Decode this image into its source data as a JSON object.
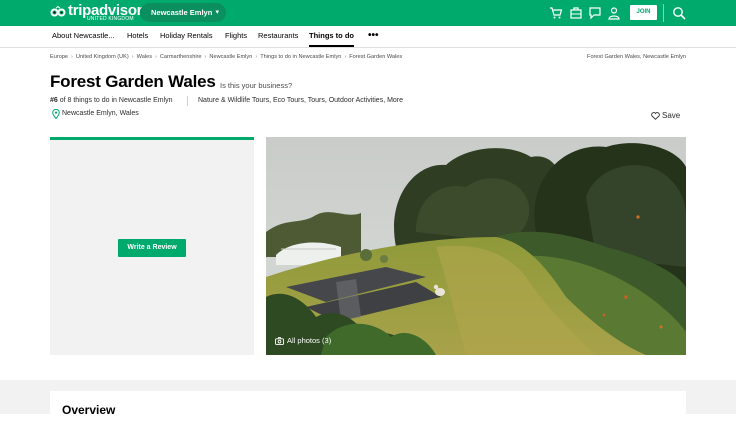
{
  "brand": {
    "name": "tripadvisor",
    "region": "UNITED KINGDOM",
    "green": "#00aa6c"
  },
  "header": {
    "geo_label": "Newcastle Emlyn",
    "join_label": "JOIN",
    "icons": [
      "cart-icon",
      "trips-icon",
      "messages-icon",
      "profile-icon",
      "search-icon"
    ]
  },
  "nav": {
    "items": [
      {
        "label": "About Newcastle..."
      },
      {
        "label": "Hotels"
      },
      {
        "label": "Holiday Rentals"
      },
      {
        "label": "Flights"
      },
      {
        "label": "Restaurants"
      },
      {
        "label": "Things to do",
        "active": true
      }
    ],
    "more": "•••"
  },
  "breadcrumb": {
    "items": [
      "Europe",
      "United Kingdom (UK)",
      "Wales",
      "Carmarthenshire",
      "Newcastle Emlyn",
      "Things to do in Newcastle Emlyn",
      "Forest Garden Wales"
    ],
    "right": "Forest Garden Wales, Newcastle Emlyn"
  },
  "listing": {
    "title": "Forest Garden Wales",
    "claim": "Is this your business?",
    "rank_number": "#6",
    "rank_text": " of 8 things to do in Newcastle Emlyn",
    "categories": "Nature & Wildlife Tours, Eco Tours, Tours, Outdoor Activities, More",
    "location": "Newcastle Emlyn, Wales",
    "save_label": "Save"
  },
  "review": {
    "button_label": "Write a Review"
  },
  "photos": {
    "caption": "All photos (3)"
  },
  "overview": {
    "title": "Overview"
  }
}
